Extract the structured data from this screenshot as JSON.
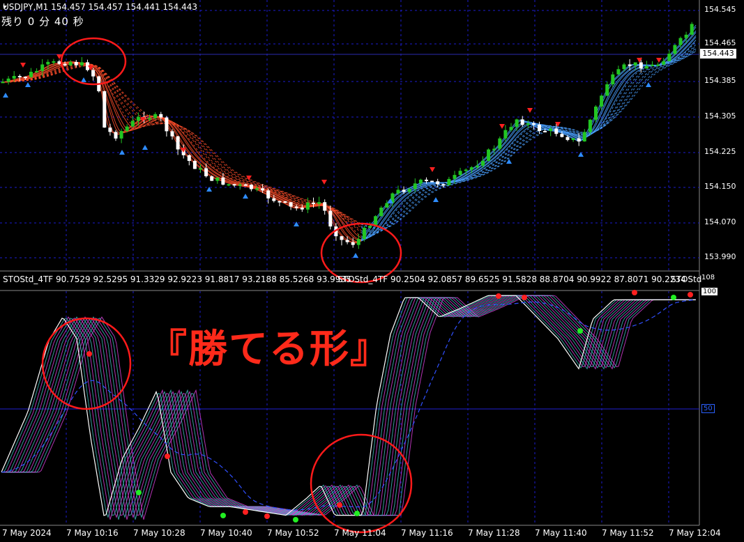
{
  "chart_title": "USDJPY,M1  154.457 154.457 154.441 154.443",
  "countdown": "残り 0 分 40 秒",
  "price_axis": [
    "154.545",
    "154.465",
    "154.385",
    "154.305",
    "154.225",
    "154.150",
    "154.070",
    "153.990"
  ],
  "current_price": "154.443",
  "indicator_header": "STOStd_4TF 90.7529 92.5295 91.3329 92.9223 91.8817 93.2188 85.5268 93.9935",
  "indicator_header2": "STOStd_4TF 90.2504 92.0857 89.6525 91.5828 88.8704 90.9922 87.8071 90.2234",
  "indicator_header3": "STOStd",
  "indicator_axis": {
    "top": "108",
    "level100": "100",
    "level50": "50"
  },
  "time_axis": [
    "7 May 2024",
    "7 May 10:16",
    "7 May 10:28",
    "7 May 10:40",
    "7 May 10:52",
    "7 May 11:04",
    "7 May 11:16",
    "7 May 11:28",
    "7 May 11:40",
    "7 May 11:52",
    "7 May 12:04"
  ],
  "caption": "『勝てる形』",
  "colors": {
    "bull_candle": "#22c622",
    "bear_candle": "#ffffff",
    "grid": "#1c1cd0",
    "buy_arrow": "#2e8cff",
    "sell_arrow": "#ff2020",
    "ribbon_down": "#ff4d2a",
    "ribbon_up": "#4aa0ff",
    "sto_magenta": "#e040e0",
    "sto_teal": "#40c0c0",
    "circle": "#ff1a1a"
  },
  "chart_data": {
    "type": "line",
    "x": [
      "10:04",
      "10:16",
      "10:28",
      "10:40",
      "10:52",
      "11:04",
      "11:16",
      "11:28",
      "11:40",
      "11:52",
      "12:04"
    ],
    "price_close": [
      154.39,
      154.43,
      154.3,
      154.16,
      154.09,
      154.01,
      154.16,
      154.19,
      154.24,
      154.43,
      154.54
    ],
    "stochastic": [
      30,
      90,
      20,
      35,
      6,
      5,
      95,
      100,
      85,
      100,
      100
    ],
    "ylim_price": [
      153.96,
      154.56
    ],
    "ylim_stochastic": [
      0,
      108
    ]
  }
}
